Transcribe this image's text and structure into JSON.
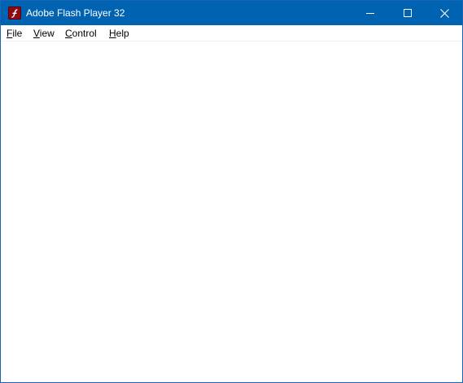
{
  "window": {
    "title": "Adobe Flash Player 32",
    "app_icon": "flash-player-icon",
    "controls": {
      "minimize_icon": "minimize-icon",
      "maximize_icon": "maximize-icon",
      "close_icon": "close-icon"
    },
    "colors": {
      "titlebar": "#0063b1",
      "border": "#1a64b5",
      "icon_bg": "#8b0a14"
    }
  },
  "menu": {
    "items": [
      {
        "accel": "F",
        "rest": "ile"
      },
      {
        "accel": "V",
        "rest": "iew"
      },
      {
        "accel": "C",
        "rest": "ontrol"
      },
      {
        "accel": "H",
        "rest": "elp"
      }
    ]
  }
}
